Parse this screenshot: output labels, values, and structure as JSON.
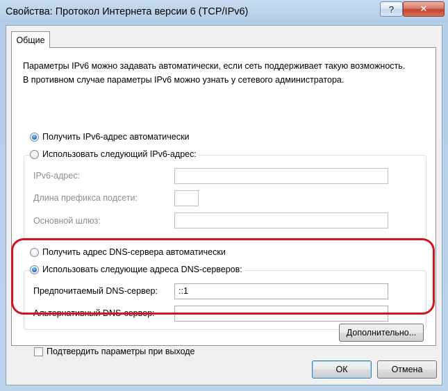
{
  "window": {
    "title": "Свойства: Протокол Интернета версии 6 (TCP/IPv6)",
    "help_glyph": "?",
    "close_glyph": "✕"
  },
  "tabs": [
    {
      "label": "Общие"
    }
  ],
  "description": "Параметры IPv6 можно задавать автоматически, если сеть поддерживает такую возможность. В противном случае параметры IPv6 можно узнать у сетевого администратора.",
  "ip": {
    "auto_label": "Получить IPv6-адрес автоматически",
    "auto_selected": true,
    "manual_label": "Использовать следующий IPv6-адрес:",
    "manual_selected": false,
    "address_label": "IPv6-адрес:",
    "address_value": "",
    "prefix_label": "Длина префикса подсети:",
    "prefix_value": "",
    "gateway_label": "Основной шлюз:",
    "gateway_value": ""
  },
  "dns": {
    "auto_label": "Получить адрес DNS-сервера автоматически",
    "auto_selected": false,
    "manual_label": "Использовать следующие адреса DNS-серверов:",
    "manual_selected": true,
    "preferred_label": "Предпочитаемый DNS-сервер:",
    "preferred_value": "::1",
    "alternate_label": "Альтернативный DNS-сервер:",
    "alternate_value": ""
  },
  "validate_on_exit": {
    "label": "Подтвердить параметры при выходе",
    "checked": false
  },
  "buttons": {
    "advanced": "Дополнительно...",
    "ok": "ОК",
    "cancel": "Отмена"
  },
  "colors": {
    "highlight": "#d4131f",
    "accent": "#1e6fc2"
  }
}
